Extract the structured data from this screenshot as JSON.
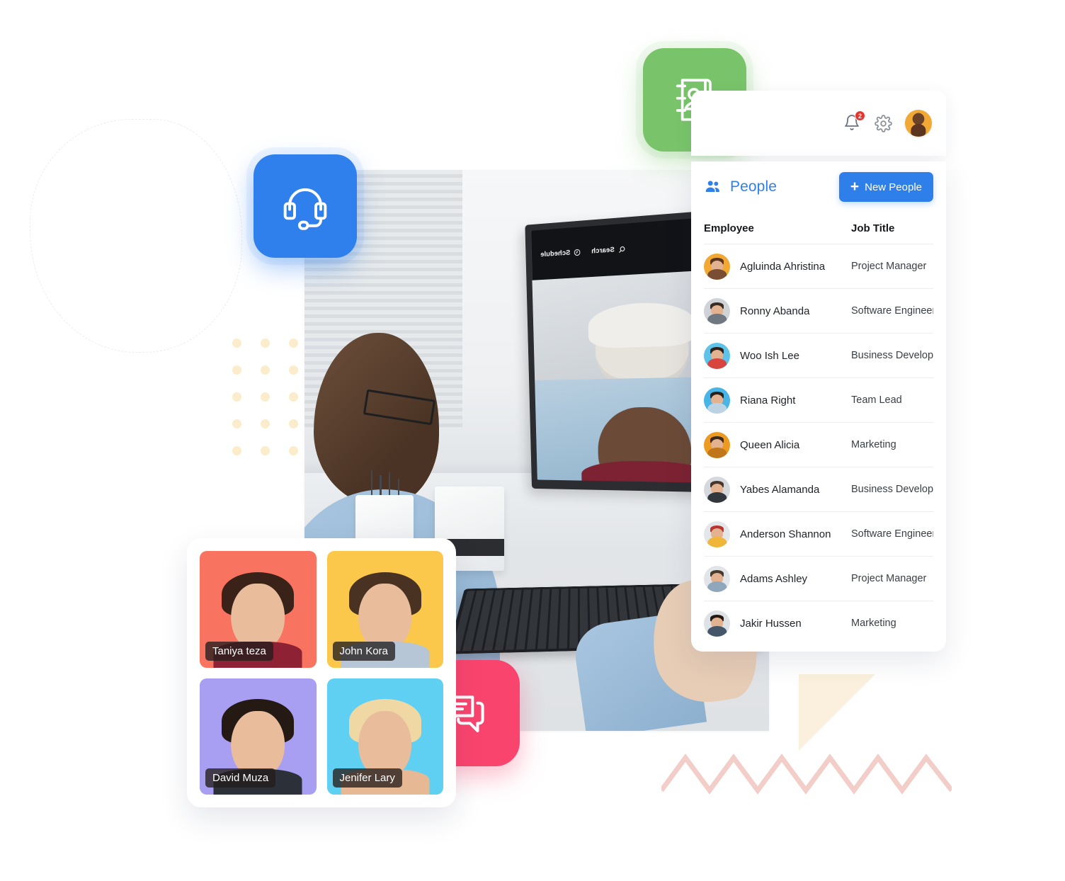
{
  "panel": {
    "topbar": {
      "notification_icon": "bell-icon",
      "notification_count": "2",
      "settings_icon": "gear-icon",
      "avatar": "user-avatar"
    },
    "header": {
      "icon": "people-group-icon",
      "title": "People",
      "new_button_label": "New People",
      "new_button_plus": "+",
      "accent_color": "#2f7fea"
    },
    "table": {
      "columns": [
        "Employee",
        "Job Title"
      ],
      "rows": [
        {
          "name": "Agluinda Ahristina",
          "job": "Project Manager",
          "avatar_bg": "#f2a933",
          "hair": "#5b3520",
          "body": "#7a4e33"
        },
        {
          "name": "Ronny Abanda",
          "job": "Software Engineer",
          "avatar_bg": "#cfd3d7",
          "hair": "#3a2c22",
          "body": "#6f7780"
        },
        {
          "name": "Woo Ish Lee",
          "job": "Business Developme",
          "avatar_bg": "#5ec3e8",
          "hair": "#2d2119",
          "body": "#d8453f"
        },
        {
          "name": "Riana Right",
          "job": "Team Lead",
          "avatar_bg": "#49b5e6",
          "hair": "#2b2119",
          "body": "#bcd3e4"
        },
        {
          "name": "Queen Alicia",
          "job": "Marketing",
          "avatar_bg": "#ec9a22",
          "hair": "#3b2a1d",
          "body": "#c2761a"
        },
        {
          "name": "Yabes Alamanda",
          "job": "Business Developme",
          "avatar_bg": "#d5d8dc",
          "hair": "#4a3628",
          "body": "#32373d"
        },
        {
          "name": "Anderson Shannon",
          "job": "Software Engineer",
          "avatar_bg": "#e4e7ea",
          "hair": "#b9352e",
          "body": "#f0b63a"
        },
        {
          "name": "Adams Ashley",
          "job": "Project Manager",
          "avatar_bg": "#e1e5e9",
          "hair": "#4a3a2c",
          "body": "#8fa6bb"
        },
        {
          "name": "Jakir Hussen",
          "job": "Marketing",
          "avatar_bg": "#dde2e7",
          "hair": "#241a14",
          "body": "#44566a"
        }
      ]
    }
  },
  "photo_grid": {
    "cards": [
      {
        "name": "Taniya teza",
        "bg": "#f97361",
        "hair": "#3a2218",
        "body": "#8e2133"
      },
      {
        "name": "John Kora",
        "bg": "#fbc84b",
        "hair": "#4a3222",
        "body": "#b7c6d6"
      },
      {
        "name": "David Muza",
        "bg": "#a89ef2",
        "hair": "#241a13",
        "body": "#2c3038"
      },
      {
        "name": "Jenifer Lary",
        "bg": "#5fd0f2",
        "hair": "#efd8a4",
        "body": "#e7b894"
      }
    ]
  },
  "floating_tiles": [
    {
      "icon": "headset-icon",
      "color": "#2f80ed"
    },
    {
      "icon": "contact-book-icon",
      "color": "#79c46b"
    },
    {
      "icon": "chat-bubbles-icon",
      "color": "#f9456e"
    }
  ],
  "screen": {
    "schedule_label": "Schedule",
    "search_label": "Search",
    "clock_icon": "clock-icon",
    "search_icon": "search-icon"
  },
  "decorations": {
    "dot_color": "#fbeccc",
    "zigzag_color": "#f3cdc8",
    "triangle_color": "#faf0dd"
  }
}
